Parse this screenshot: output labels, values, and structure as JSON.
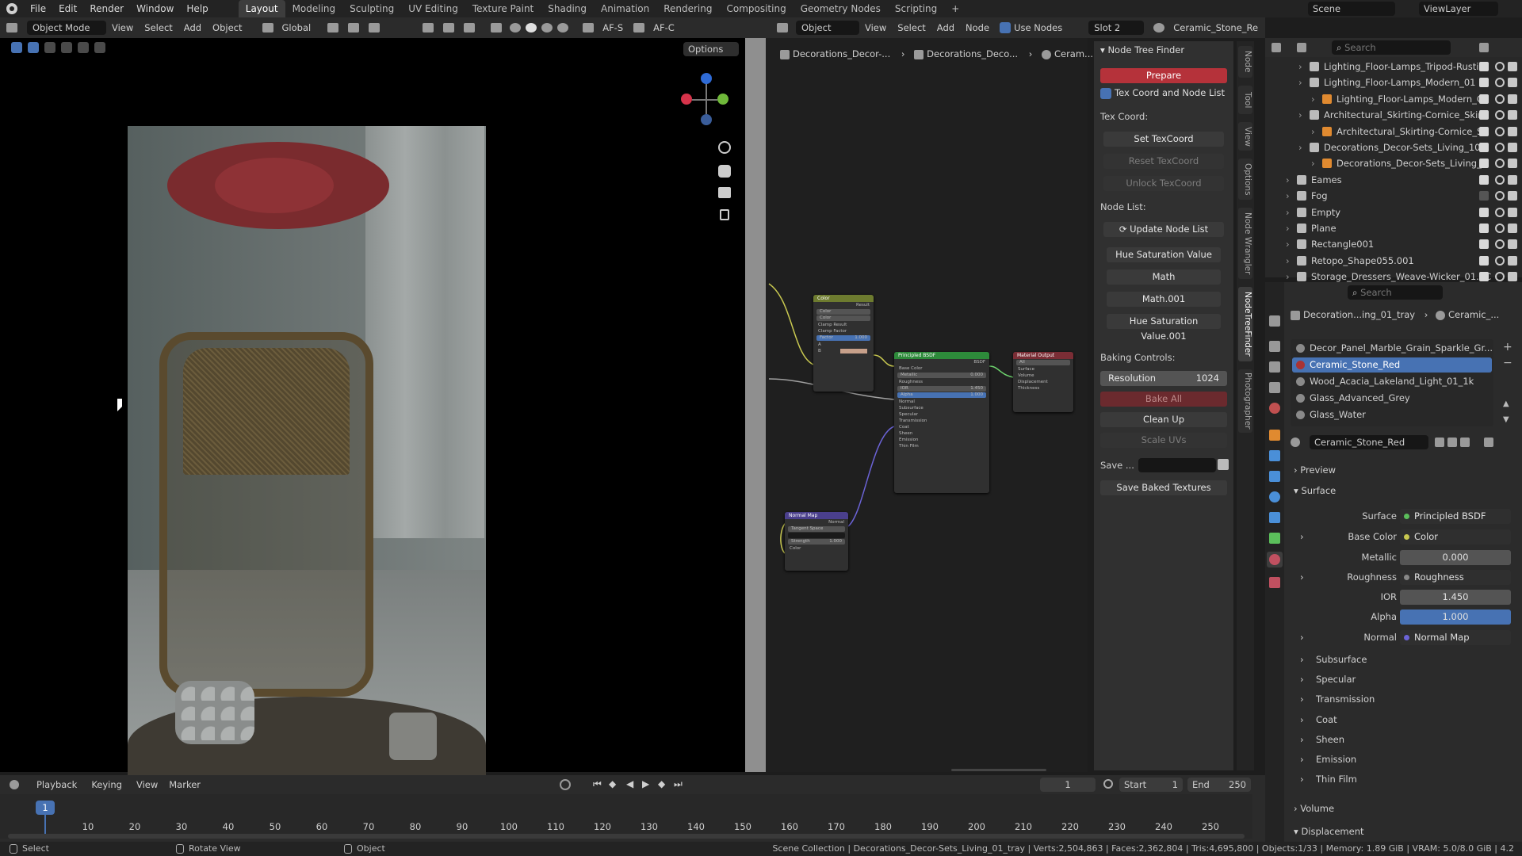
{
  "menubar": {
    "items": [
      "File",
      "Edit",
      "Render",
      "Window",
      "Help"
    ],
    "workspaces": [
      "Layout",
      "Modeling",
      "Sculpting",
      "UV Editing",
      "Texture Paint",
      "Shading",
      "Animation",
      "Rendering",
      "Compositing",
      "Geometry Nodes",
      "Scripting"
    ],
    "active_workspace": "Layout",
    "scene": "Scene",
    "view_layer": "ViewLayer"
  },
  "viewport_header": {
    "mode": "Object Mode",
    "menus": [
      "View",
      "Select",
      "Add",
      "Object"
    ],
    "orientation": "Global",
    "af_s": "AF-S",
    "af_c": "AF-C",
    "options": "Options"
  },
  "node_header": {
    "object": "Object",
    "menus": [
      "View",
      "Select",
      "Add",
      "Node"
    ],
    "use_nodes": "Use Nodes",
    "slot": "Slot 2",
    "material": "Ceramic_Stone_Re"
  },
  "breadcrumb": {
    "a": "Decorations_Decor-...",
    "b": "Decorations_Deco...",
    "c": "Ceram..."
  },
  "nodes": {
    "color": {
      "title": "Color",
      "result": "Result",
      "s1": "Color",
      "s2": "Color",
      "clamp_result": "Clamp Result",
      "clamp_factor": "Clamp Factor",
      "factor": "Factor",
      "factor_val": "1.000",
      "a": "A",
      "b": "B"
    },
    "bsdf": {
      "title": "Principled BSDF",
      "out": "BSDF",
      "base": "Base Color",
      "metallic": "Metallic",
      "metallic_val": "0.000",
      "roughness": "Roughness",
      "ior": "IOR",
      "ior_val": "1.450",
      "alpha": "Alpha",
      "alpha_val": "1.000",
      "normal": "Normal",
      "subs": [
        "Subsurface",
        "Specular",
        "Transmission",
        "Coat",
        "Sheen",
        "Emission",
        "Thin Film"
      ]
    },
    "output": {
      "title": "Material Output",
      "target": "All",
      "rows": [
        "Surface",
        "Volume",
        "Displacement",
        "Thickness"
      ]
    },
    "normal_map": {
      "title": "Normal Map",
      "out": "Normal",
      "space": "Tangent Space",
      "strength": "Strength",
      "strength_val": "1.000",
      "color": "Color"
    }
  },
  "node_tree_finder": {
    "title": "Node Tree Finder",
    "prepare": "Prepare",
    "tex_coord_toggle": "Tex Coord and Node List",
    "tex_coord_label": "Tex Coord:",
    "set_texcoord": "Set TexCoord",
    "reset_texcoord": "Reset TexCoord",
    "unlock_texcoord": "Unlock TexCoord",
    "node_list_label": "Node List:",
    "update_node_list": "Update Node List",
    "node_buttons": [
      "Hue Saturation Value",
      "Math",
      "Math.001",
      "Hue Saturation Value.001"
    ],
    "baking_label": "Baking Controls:",
    "resolution_label": "Resolution",
    "resolution_value": "1024",
    "bake_all": "Bake All",
    "clean_up": "Clean Up",
    "scale_uvs": "Scale UVs",
    "save_label": "Save ...",
    "save_baked": "Save Baked Textures"
  },
  "side_tabs": [
    "Node",
    "Tool",
    "View",
    "Options",
    "Node Wrangler",
    "NodeTreeFinder",
    "Photographer"
  ],
  "outliner": {
    "search_placeholder": "Search",
    "rows": [
      {
        "name": "Lighting_Floor-Lamps_Tripod-Rustic",
        "indent": 2
      },
      {
        "name": "Lighting_Floor-Lamps_Modern_01",
        "indent": 2
      },
      {
        "name": "Lighting_Floor-Lamps_Modern_C",
        "indent": 3
      },
      {
        "name": "Architectural_Skirting-Cornice_Skirti",
        "indent": 2
      },
      {
        "name": "Architectural_Skirting-Cornice_S",
        "indent": 3
      },
      {
        "name": "Decorations_Decor-Sets_Living_10",
        "indent": 2
      },
      {
        "name": "Decorations_Decor-Sets_Living_",
        "indent": 3
      },
      {
        "name": "Eames",
        "indent": 1
      },
      {
        "name": "Fog",
        "indent": 1
      },
      {
        "name": "Empty",
        "indent": 1
      },
      {
        "name": "Plane",
        "indent": 1
      },
      {
        "name": "Rectangle001",
        "indent": 1
      },
      {
        "name": "Retopo_Shape055.001",
        "indent": 1
      },
      {
        "name": "Storage_Dressers_Weave-Wicker_01.0C",
        "indent": 1
      }
    ]
  },
  "properties": {
    "search_placeholder": "Search",
    "breadcrumb_a": "Decoration...ing_01_tray",
    "breadcrumb_b": "Ceramic_...",
    "slots": [
      "Decor_Panel_Marble_Grain_Sparkle_Gr...",
      "Ceramic_Stone_Red",
      "Wood_Acacia_Lakeland_Light_01_1k",
      "Glass_Advanced_Grey",
      "Glass_Water"
    ],
    "active_slot": "Ceramic_Stone_Red",
    "material_name": "Ceramic_Stone_Red",
    "preview": "Preview",
    "surface_panel": "Surface",
    "surface_label": "Surface",
    "surface_value": "Principled BSDF",
    "base_color_label": "Base Color",
    "base_color_value": "Color",
    "metallic_label": "Metallic",
    "metallic_value": "0.000",
    "roughness_label": "Roughness",
    "roughness_value": "Roughness",
    "ior_label": "IOR",
    "ior_value": "1.450",
    "alpha_label": "Alpha",
    "alpha_value": "1.000",
    "normal_label": "Normal",
    "normal_value": "Normal Map",
    "subpanels": [
      "Subsurface",
      "Specular",
      "Transmission",
      "Coat",
      "Sheen",
      "Emission",
      "Thin Film"
    ],
    "volume": "Volume",
    "displacement": "Displacement"
  },
  "timeline": {
    "menus": [
      "Playback",
      "Keying",
      "View",
      "Marker"
    ],
    "current_frame": "1",
    "start_label": "Start",
    "start": "1",
    "end_label": "End",
    "end": "250",
    "ticks": [
      "1",
      "10",
      "20",
      "30",
      "40",
      "50",
      "60",
      "70",
      "80",
      "90",
      "100",
      "110",
      "120",
      "130",
      "140",
      "150",
      "160",
      "170",
      "180",
      "190",
      "200",
      "210",
      "220",
      "230",
      "240",
      "250"
    ]
  },
  "statusbar": {
    "select": "Select",
    "rotate": "Rotate View",
    "object": "Object",
    "info": "Scene Collection | Decorations_Decor-Sets_Living_01_tray | Verts:2,504,863 | Faces:2,362,804 | Tris:4,695,800 | Objects:1/33 | Memory: 1.89 GiB | VRAM: 5.0/8.0 GiB | 4.2"
  }
}
